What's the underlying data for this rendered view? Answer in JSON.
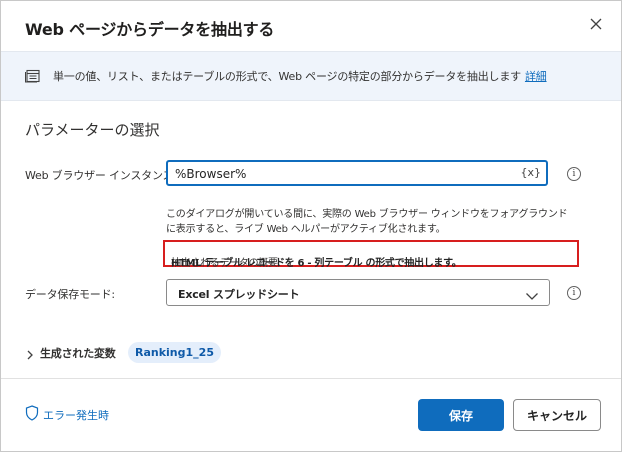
{
  "dialog": {
    "title": "Web ページからデータを抽出する",
    "close_icon": "close-icon"
  },
  "info_bar": {
    "icon": "action-info-icon",
    "text": "単一の値、リスト、またはテーブルの形式で、Web ページの特定の部分からデータを抽出します",
    "link": "詳細"
  },
  "section_title": "パラメーターの選択",
  "browser_instance": {
    "label": "Web ブラウザー インスタンス:",
    "value": "%Browser%",
    "variable_button": "{x}",
    "help_icon": "info-circle-icon"
  },
  "description": "このダイアログが開いている間に、実際の Web ブラウザー ウィンドウをフォアグラウンドに表示すると、ライブ Web ヘルパーがアクティブ化されます。",
  "summary": {
    "prefix": "抽出されるデータの概要: ",
    "bold": "HTML テーブル レコードを 6 - 列テーブル の形式で抽出します。"
  },
  "storage_mode": {
    "label": "データ保存モード:",
    "value": "Excel スプレッドシート",
    "help_icon": "info-circle-icon"
  },
  "generated_vars": {
    "label": "生成された変数",
    "chip": "Ranking1_25"
  },
  "footer": {
    "on_error": "エラー発生時",
    "save": "保存",
    "cancel": "キャンセル"
  },
  "colors": {
    "accent": "#0f6cbd",
    "info_bg": "#eff4fb",
    "highlight_border": "#d71e1e",
    "chip_bg": "#e4eefb"
  }
}
